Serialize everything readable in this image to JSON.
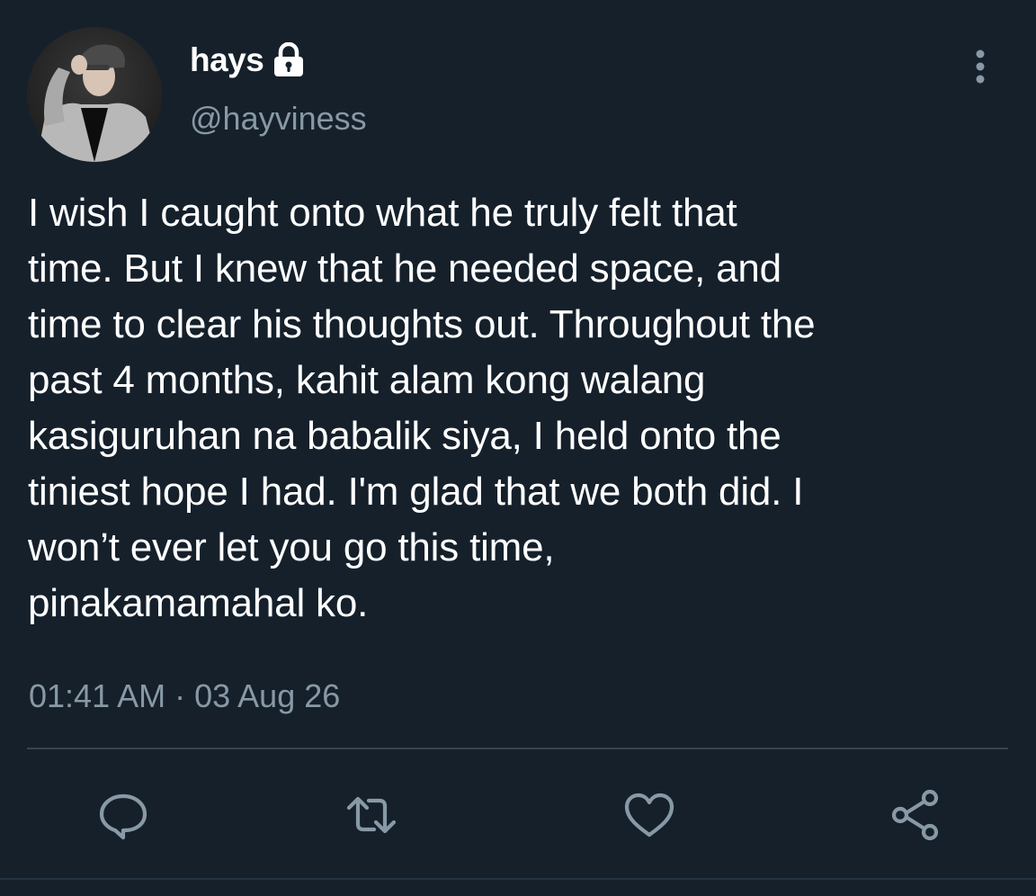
{
  "user": {
    "display_name": "hays",
    "handle": "@hayviness",
    "avatar_icon": "profile-photo",
    "protected_icon": "lock-icon"
  },
  "tweet": {
    "text": "I wish I caught onto what he truly felt that\ntime. But I knew that he needed space, and\ntime to clear his thoughts out. Throughout the\npast 4 months, kahit alam kong walang\nkasiguruhan na babalik siya, I held onto the\ntiniest hope I had. I'm glad that we both did. I\nwon’t ever let you go this time,\npinakamamahal ko.",
    "timestamp": "01:41 AM · 03 Aug 26"
  },
  "actions": [
    {
      "name": "reply",
      "icon": "reply-icon"
    },
    {
      "name": "retweet",
      "icon": "retweet-icon"
    },
    {
      "name": "like",
      "icon": "heart-icon"
    },
    {
      "name": "share",
      "icon": "share-icon"
    }
  ],
  "colors": {
    "background": "#15202b",
    "primary_text": "#ffffff",
    "secondary_text": "#8899a6",
    "divider": "#38444d"
  }
}
